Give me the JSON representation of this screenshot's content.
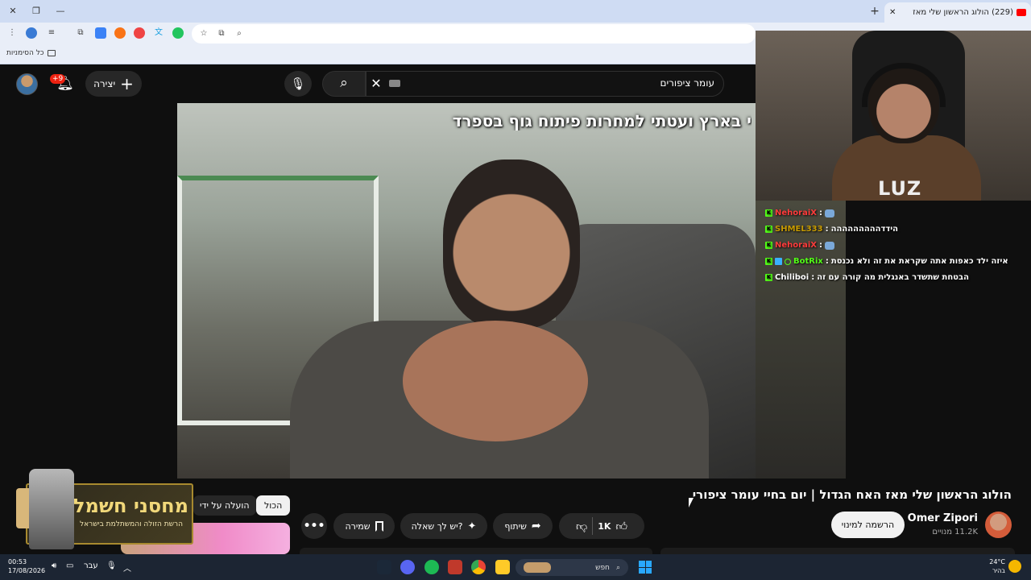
{
  "browser": {
    "tab_title": "(229) הולוג הראשון שלי מאז",
    "bookmarks_label": "כל הסימניות"
  },
  "masthead": {
    "create_label": "יצירה",
    "notifications_badge": "+9",
    "search_query": "עומר ציפורים"
  },
  "video": {
    "caption": "י בארץ ועטתי למחרות פיתוח גוף בספרד",
    "title": "הולוג הראשון שלי מאז האח הגדול | יום בחיי עומר ציפורי"
  },
  "stream_overlay": {
    "logo": "LUZ",
    "chat": [
      {
        "user": "NehoraiX",
        "user_color": "#ff3b3b",
        "message": "",
        "has_mod": false
      },
      {
        "user": "SHMEL333",
        "user_color": "#c79a00",
        "message": "הידדההההההההה",
        "has_mod": false
      },
      {
        "user": "NehoraiX",
        "user_color": "#ff3b3b",
        "message": "",
        "has_mod": false
      },
      {
        "user": "BotRix",
        "user_color": "#53fc18",
        "message": "איזה ילד כאפות אתה שקראת את זה ולא נכנסת",
        "has_mod": true
      },
      {
        "user": "Chiliboi",
        "user_color": "#ffffff",
        "message": "הבטחת שתשדר באנגלית מה קורה עם זה",
        "has_mod": false
      }
    ]
  },
  "channel": {
    "name": "Omer Zipori",
    "subscribers": "11.2K מנויים",
    "subscribe_label": "הרשמה למינוי"
  },
  "actions": {
    "like_count": "1K",
    "share_label": "שיתוף",
    "ask_label": "יש לך שאלה?",
    "save_label": "שמירה"
  },
  "filters": {
    "all_label": "הכול",
    "uploader_label": "הועלה על ידי"
  },
  "sponsor": {
    "name": "מחסני חשמל",
    "tagline": "הרשת הזולה והמשתלמת בישראל"
  },
  "taskbar": {
    "time": "00:53",
    "date": "17/08/2026",
    "language": "עבר",
    "search_label": "חפש",
    "temperature": "24°C",
    "weather_desc": "בהיר"
  },
  "colors": {
    "accent_red": "#ff0000",
    "kick_green": "#53fc18"
  }
}
